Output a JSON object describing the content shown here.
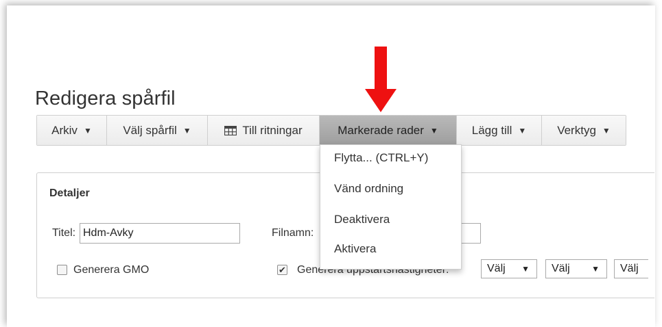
{
  "page": {
    "title": "Redigera spårfil"
  },
  "toolbar": {
    "arkiv": "Arkiv",
    "valj_sparfil": "Välj spårfil",
    "till_ritningar": "Till ritningar",
    "markerade_rader": "Markerade rader",
    "lagg_till": "Lägg till",
    "verktyg": "Verktyg",
    "caret": "▼"
  },
  "dropdown": {
    "items": [
      "Flytta... (CTRL+Y)",
      "Vänd ordning",
      "Deaktivera",
      "Aktivera"
    ]
  },
  "details": {
    "heading": "Detaljer",
    "titel_label": "Titel:",
    "titel_value": "Hdm-Avky",
    "filnamn_label": "Filnamn:",
    "filnamn_value": "",
    "generera_gmo_label": "Generera GMO",
    "generera_gmo_checked": false,
    "generera_uppstart_label": "Generera uppstartshastigheter:",
    "generera_uppstart_checked": true,
    "selects": [
      "Välj",
      "Välj",
      "Välj"
    ]
  },
  "colors": {
    "arrow": "#ee1111",
    "active_tab": "#a8a8a8"
  },
  "icons": {
    "till_ritningar": "table-grid-icon",
    "annotation": "red-down-arrow"
  }
}
